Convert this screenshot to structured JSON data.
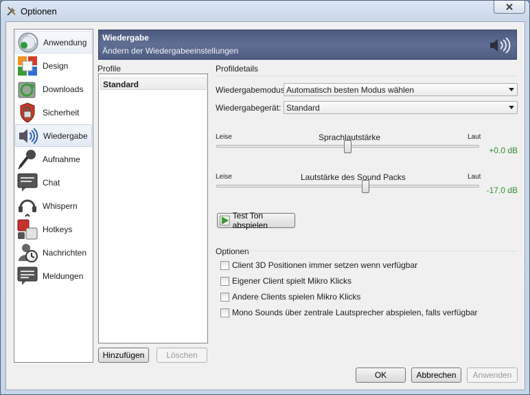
{
  "window": {
    "title": "Optionen"
  },
  "sidebar": {
    "items": [
      {
        "label": "Anwendung",
        "icon": "application-icon"
      },
      {
        "label": "Design",
        "icon": "design-icon"
      },
      {
        "label": "Downloads",
        "icon": "downloads-icon"
      },
      {
        "label": "Sicherheit",
        "icon": "security-lock-icon"
      },
      {
        "label": "Wiedergabe",
        "icon": "speaker-icon"
      },
      {
        "label": "Aufnahme",
        "icon": "microphone-icon"
      },
      {
        "label": "Chat",
        "icon": "chat-icon"
      },
      {
        "label": "Whispern",
        "icon": "headset-icon"
      },
      {
        "label": "Hotkeys",
        "icon": "hotkeys-icon"
      },
      {
        "label": "Nachrichten",
        "icon": "messages-icon"
      },
      {
        "label": "Meldungen",
        "icon": "notifications-icon"
      }
    ],
    "active_index": 4
  },
  "banner": {
    "title": "Wiedergabe",
    "subtitle": "Ändern der Wiedergabeeinstellungen"
  },
  "profiles": {
    "heading": "Profile",
    "items": [
      "Standard"
    ],
    "add_label": "Hinzufügen",
    "delete_label": "Löschen"
  },
  "details": {
    "heading": "Profildetails",
    "mode_label": "Wiedergabemodus:",
    "mode_value": "Automatisch besten Modus wählen",
    "device_label": "Wiedergabegerät:",
    "device_value": "Standard",
    "voice": {
      "title": "Sprachlautstärke",
      "min_label": "Leise",
      "max_label": "Laut",
      "value": "+0.0 dB",
      "position": 0.5
    },
    "soundpack": {
      "title": "Lautstärke des Sound Packs",
      "min_label": "Leise",
      "max_label": "Laut",
      "value": "-17.0 dB",
      "position": 0.57
    },
    "test_button": "Test Ton abspielen"
  },
  "options": {
    "heading": "Optionen",
    "checkboxes": [
      {
        "label": "Client 3D Positionen immer setzen wenn verfügbar",
        "checked": false
      },
      {
        "label": "Eigener Client spielt Mikro Klicks",
        "checked": false
      },
      {
        "label": "Andere Clients spielen Mikro Klicks",
        "checked": false
      },
      {
        "label": "Mono Sounds über zentrale Lautsprecher abspielen, falls verfügbar",
        "checked": false
      }
    ]
  },
  "footer": {
    "ok": "OK",
    "cancel": "Abbrechen",
    "apply": "Anwenden"
  }
}
